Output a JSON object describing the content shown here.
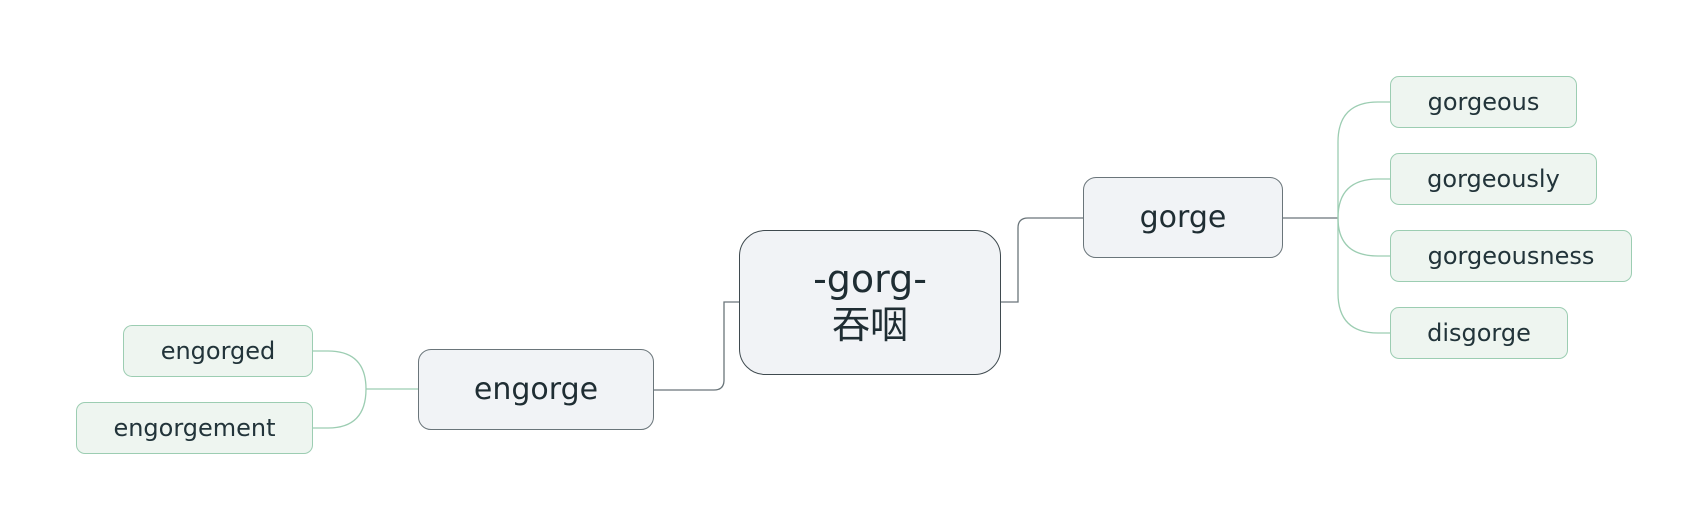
{
  "mindmap": {
    "root": {
      "line1": "-gorg-",
      "line2": "吞咽"
    },
    "right": {
      "label": "gorge",
      "children": [
        "gorgeous",
        "gorgeously",
        "gorgeousness",
        "disgorge"
      ]
    },
    "left": {
      "label": "engorge",
      "children": [
        "engorged",
        "engorgement"
      ]
    }
  },
  "colors": {
    "root_border": "#3f4a4f",
    "branch_fill": "#f1f3f6",
    "leaf_fill": "#eef5f0",
    "leaf_border": "#9ccdb2",
    "branch_connector": "#6a757a",
    "leaf_connector": "#9ccdb2"
  }
}
